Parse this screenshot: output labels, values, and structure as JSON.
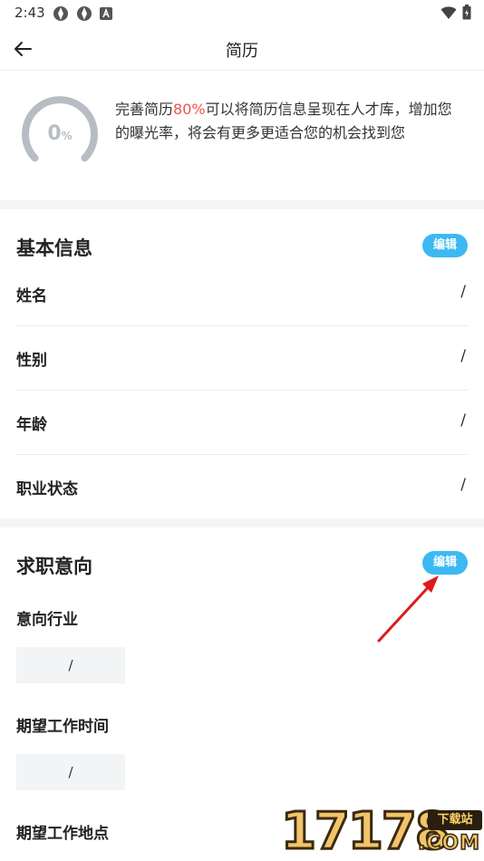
{
  "status_bar": {
    "time": "2:43"
  },
  "header": {
    "title": "简历"
  },
  "progress": {
    "value_number": "0",
    "value_unit": "%",
    "desc_prefix": "完善简历",
    "desc_highlight": "80%",
    "desc_suffix": "可以将简历信息呈现在人才库，增加您的曝光率，将会有更多更适合您的机会找到您",
    "percent_complete": 0
  },
  "basic_info": {
    "title": "基本信息",
    "edit_label": "编辑",
    "rows": [
      {
        "label": "姓名",
        "value": "/"
      },
      {
        "label": "性别",
        "value": "/"
      },
      {
        "label": "年龄",
        "value": "/"
      },
      {
        "label": "职业状态",
        "value": "/"
      }
    ]
  },
  "job_intention": {
    "title": "求职意向",
    "edit_label": "编辑",
    "fields": [
      {
        "label": "意向行业",
        "value": "/"
      },
      {
        "label": "期望工作时间",
        "value": "/"
      },
      {
        "label": "期望工作地点"
      }
    ]
  },
  "watermark": {
    "digits": "17178",
    "tag": "下载站",
    "suffix": ".COM"
  },
  "colors": {
    "accent": "#3cb9f2",
    "highlight": "#f0524a",
    "gauge_track": "#b8bcc4",
    "annotation_arrow": "#e0191b"
  }
}
